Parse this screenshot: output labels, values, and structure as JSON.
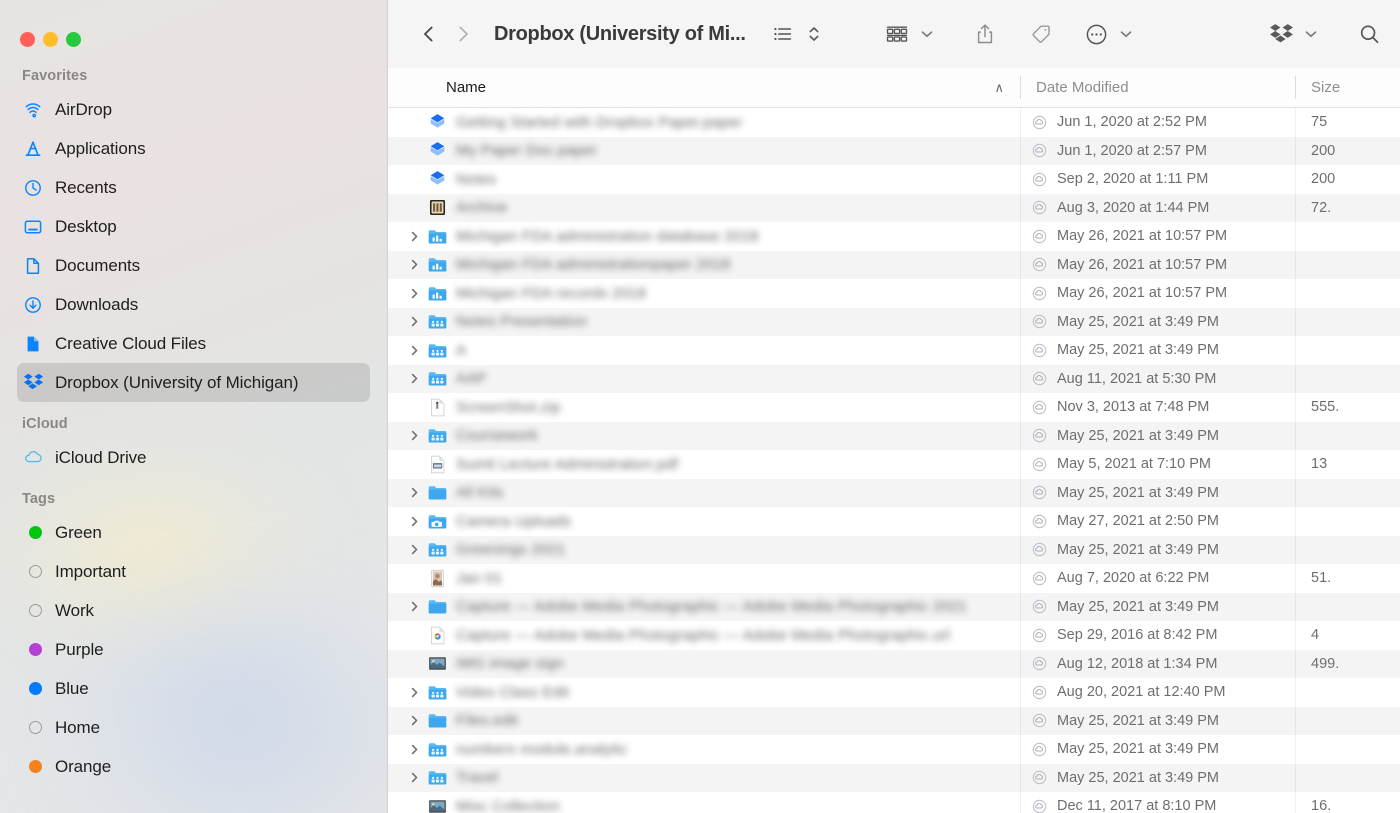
{
  "window": {
    "title": "Dropbox (University of Mi...",
    "traffic_lights": [
      {
        "name": "close",
        "color": "#ff5f57"
      },
      {
        "name": "minimize",
        "color": "#ffbd2e"
      },
      {
        "name": "maximize",
        "color": "#28c840"
      }
    ]
  },
  "toolbar": {
    "back_icon": "chevron-left-icon",
    "forward_icon": "chevron-right-icon",
    "view_list_icon": "list-view-icon",
    "view_sort_icon": "sort-updown-icon",
    "group_icon": "group-items-icon",
    "share_icon": "share-icon",
    "tag_icon": "tag-icon",
    "more_icon": "more-ellipsis-icon",
    "dropbox_icon": "dropbox-icon",
    "search_icon": "search-icon",
    "chevron_down_icon": "chevron-down-icon"
  },
  "sidebar": {
    "sections": [
      {
        "title": "Favorites",
        "items": [
          {
            "label": "AirDrop",
            "icon": "airdrop-icon",
            "selected": false
          },
          {
            "label": "Applications",
            "icon": "applications-icon",
            "selected": false
          },
          {
            "label": "Recents",
            "icon": "recents-clock-icon",
            "selected": false
          },
          {
            "label": "Desktop",
            "icon": "desktop-icon",
            "selected": false
          },
          {
            "label": "Documents",
            "icon": "documents-icon",
            "selected": false
          },
          {
            "label": "Downloads",
            "icon": "downloads-icon",
            "selected": false
          },
          {
            "label": "Creative Cloud Files",
            "icon": "creative-cloud-icon",
            "selected": false
          },
          {
            "label": "Dropbox (University of Michigan)",
            "icon": "dropbox-icon",
            "selected": true
          }
        ]
      },
      {
        "title": "iCloud",
        "items": [
          {
            "label": "iCloud Drive",
            "icon": "icloud-drive-icon",
            "selected": false
          }
        ]
      },
      {
        "title": "Tags",
        "items": [
          {
            "label": "Green",
            "icon": "tag-dot-icon",
            "color": "#00c613",
            "selected": false
          },
          {
            "label": "Important",
            "icon": "tag-dot-icon",
            "color": "none",
            "selected": false
          },
          {
            "label": "Work",
            "icon": "tag-dot-icon",
            "color": "none",
            "selected": false
          },
          {
            "label": "Purple",
            "icon": "tag-dot-icon",
            "color": "#b540d8",
            "selected": false
          },
          {
            "label": "Blue",
            "icon": "tag-dot-icon",
            "color": "#007aff",
            "selected": false
          },
          {
            "label": "Home",
            "icon": "tag-dot-icon",
            "color": "none",
            "selected": false
          },
          {
            "label": "Orange",
            "icon": "tag-dot-icon",
            "color": "#f7821b",
            "selected": false
          }
        ]
      }
    ]
  },
  "file_browser": {
    "columns": [
      {
        "label": "Name",
        "sorted": true,
        "sort_direction": "ascending",
        "sort_glyph": "∧"
      },
      {
        "label": "Date Modified",
        "sorted": false,
        "sort_direction": "",
        "sort_glyph": ""
      },
      {
        "label": "Size",
        "sorted": false,
        "sort_direction": "",
        "sort_glyph": ""
      }
    ],
    "rows": [
      {
        "name": "",
        "redacted": true,
        "icon": "dropbox-paper-icon",
        "expandable": false,
        "cloud_status": "online-only",
        "date": "Jun 1, 2020 at 2:52 PM",
        "size": "75 "
      },
      {
        "name": "",
        "redacted": true,
        "icon": "dropbox-paper-icon",
        "expandable": false,
        "cloud_status": "online-only",
        "date": "Jun 1, 2020 at 2:57 PM",
        "size": "200 "
      },
      {
        "name": "",
        "redacted": true,
        "icon": "dropbox-paper-icon",
        "expandable": false,
        "cloud_status": "online-only",
        "date": "Sep 2, 2020 at 1:11 PM",
        "size": "200 "
      },
      {
        "name": "",
        "redacted": true,
        "icon": "archive-file-icon",
        "expandable": false,
        "cloud_status": "online-only",
        "date": "Aug 3, 2020 at 1:44 PM",
        "size": "72."
      },
      {
        "name": "",
        "redacted": true,
        "icon": "dropbox-folder-icon",
        "expandable": true,
        "cloud_status": "online-only",
        "date": "May 26, 2021 at 10:57 PM",
        "size": ""
      },
      {
        "name": "",
        "redacted": true,
        "icon": "dropbox-folder-icon",
        "expandable": true,
        "cloud_status": "online-only",
        "date": "May 26, 2021 at 10:57 PM",
        "size": ""
      },
      {
        "name": "",
        "redacted": true,
        "icon": "dropbox-folder-icon",
        "expandable": true,
        "cloud_status": "online-only",
        "date": "May 26, 2021 at 10:57 PM",
        "size": ""
      },
      {
        "name": "",
        "redacted": true,
        "icon": "shared-folder-icon",
        "expandable": true,
        "cloud_status": "online-only",
        "date": "May 25, 2021 at 3:49 PM",
        "size": ""
      },
      {
        "name": "",
        "redacted": true,
        "icon": "shared-folder-icon",
        "expandable": true,
        "cloud_status": "online-only",
        "date": "May 25, 2021 at 3:49 PM",
        "size": ""
      },
      {
        "name": "",
        "redacted": true,
        "icon": "shared-folder-icon",
        "expandable": true,
        "cloud_status": "online-only",
        "date": "Aug 11, 2021 at 5:30 PM",
        "size": ""
      },
      {
        "name": "",
        "redacted": true,
        "icon": "document-file-icon",
        "expandable": false,
        "cloud_status": "online-only",
        "date": "Nov 3, 2013 at 7:48 PM",
        "size": "555."
      },
      {
        "name": "",
        "redacted": true,
        "icon": "shared-folder-icon",
        "expandable": true,
        "cloud_status": "online-only",
        "date": "May 25, 2021 at 3:49 PM",
        "size": ""
      },
      {
        "name": "",
        "redacted": true,
        "icon": "pdf-file-icon",
        "expandable": false,
        "cloud_status": "online-only",
        "date": "May 5, 2021 at 7:10 PM",
        "size": "13"
      },
      {
        "name": "",
        "redacted": true,
        "icon": "plain-folder-icon",
        "expandable": true,
        "cloud_status": "online-only",
        "date": "May 25, 2021 at 3:49 PM",
        "size": ""
      },
      {
        "name": "",
        "redacted": true,
        "icon": "camera-folder-icon",
        "expandable": true,
        "cloud_status": "online-only",
        "date": "May 27, 2021 at 2:50 PM",
        "size": ""
      },
      {
        "name": "",
        "redacted": true,
        "icon": "shared-folder-icon",
        "expandable": true,
        "cloud_status": "online-only",
        "date": "May 25, 2021 at 3:49 PM",
        "size": ""
      },
      {
        "name": "",
        "redacted": true,
        "icon": "image-file-icon",
        "expandable": false,
        "cloud_status": "online-only",
        "date": "Aug 7, 2020 at 6:22 PM",
        "size": "51."
      },
      {
        "name": "",
        "redacted": true,
        "icon": "plain-folder-icon",
        "expandable": true,
        "cloud_status": "online-only",
        "date": "May 25, 2021 at 3:49 PM",
        "size": ""
      },
      {
        "name": "",
        "redacted": true,
        "icon": "chrome-file-icon",
        "expandable": false,
        "cloud_status": "online-only",
        "date": "Sep 29, 2016 at 8:42 PM",
        "size": "4"
      },
      {
        "name": "",
        "redacted": true,
        "icon": "photo-file-icon",
        "expandable": false,
        "cloud_status": "online-only",
        "date": "Aug 12, 2018 at 1:34 PM",
        "size": "499."
      },
      {
        "name": "",
        "redacted": true,
        "icon": "shared-folder-icon",
        "expandable": true,
        "cloud_status": "online-only",
        "date": "Aug 20, 2021 at 12:40 PM",
        "size": ""
      },
      {
        "name": "",
        "redacted": true,
        "icon": "plain-folder-icon",
        "expandable": true,
        "cloud_status": "online-only",
        "date": "May 25, 2021 at 3:49 PM",
        "size": ""
      },
      {
        "name": "",
        "redacted": true,
        "icon": "shared-folder-icon",
        "expandable": true,
        "cloud_status": "online-only",
        "date": "May 25, 2021 at 3:49 PM",
        "size": ""
      },
      {
        "name": "",
        "redacted": true,
        "icon": "shared-folder-icon",
        "expandable": true,
        "cloud_status": "online-only",
        "date": "May 25, 2021 at 3:49 PM",
        "size": ""
      },
      {
        "name": "",
        "redacted": true,
        "icon": "photo-file-icon",
        "expandable": false,
        "cloud_status": "online-only",
        "date": "Dec 11, 2017 at 8:10 PM",
        "size": "16."
      }
    ]
  }
}
